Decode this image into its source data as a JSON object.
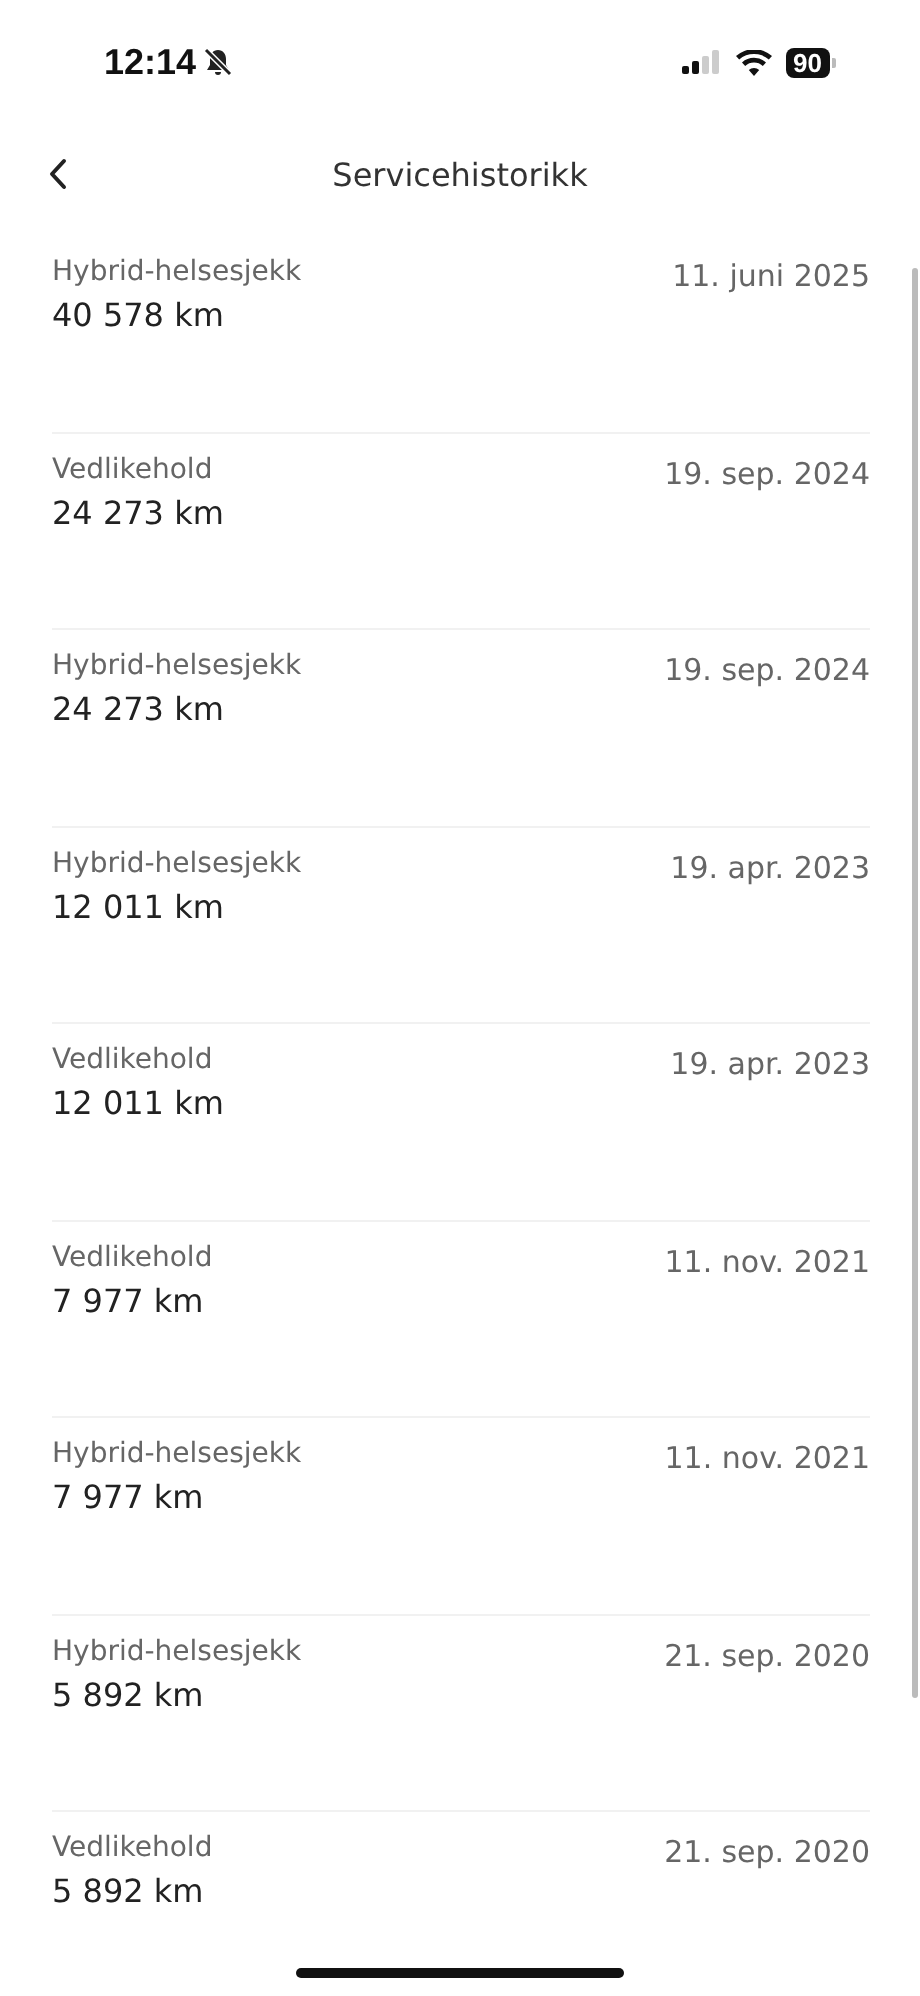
{
  "status_bar": {
    "time": "12:14",
    "battery": "90"
  },
  "header": {
    "title": "Servicehistorikk"
  },
  "services": [
    {
      "type": "Hybrid-helsesjekk",
      "mileage": "40 578 km",
      "date": "11. juni 2025"
    },
    {
      "type": "Vedlikehold",
      "mileage": "24 273 km",
      "date": "19. sep. 2024"
    },
    {
      "type": "Hybrid-helsesjekk",
      "mileage": "24 273 km",
      "date": "19. sep. 2024"
    },
    {
      "type": "Hybrid-helsesjekk",
      "mileage": "12 011 km",
      "date": "19. apr. 2023"
    },
    {
      "type": "Vedlikehold",
      "mileage": "12 011 km",
      "date": "19. apr. 2023"
    },
    {
      "type": "Vedlikehold",
      "mileage": "7 977 km",
      "date": "11. nov. 2021"
    },
    {
      "type": "Hybrid-helsesjekk",
      "mileage": "7 977 km",
      "date": "11. nov. 2021"
    },
    {
      "type": "Hybrid-helsesjekk",
      "mileage": "5 892 km",
      "date": "21. sep. 2020"
    },
    {
      "type": "Vedlikehold",
      "mileage": "5 892 km",
      "date": "21. sep. 2020"
    }
  ]
}
